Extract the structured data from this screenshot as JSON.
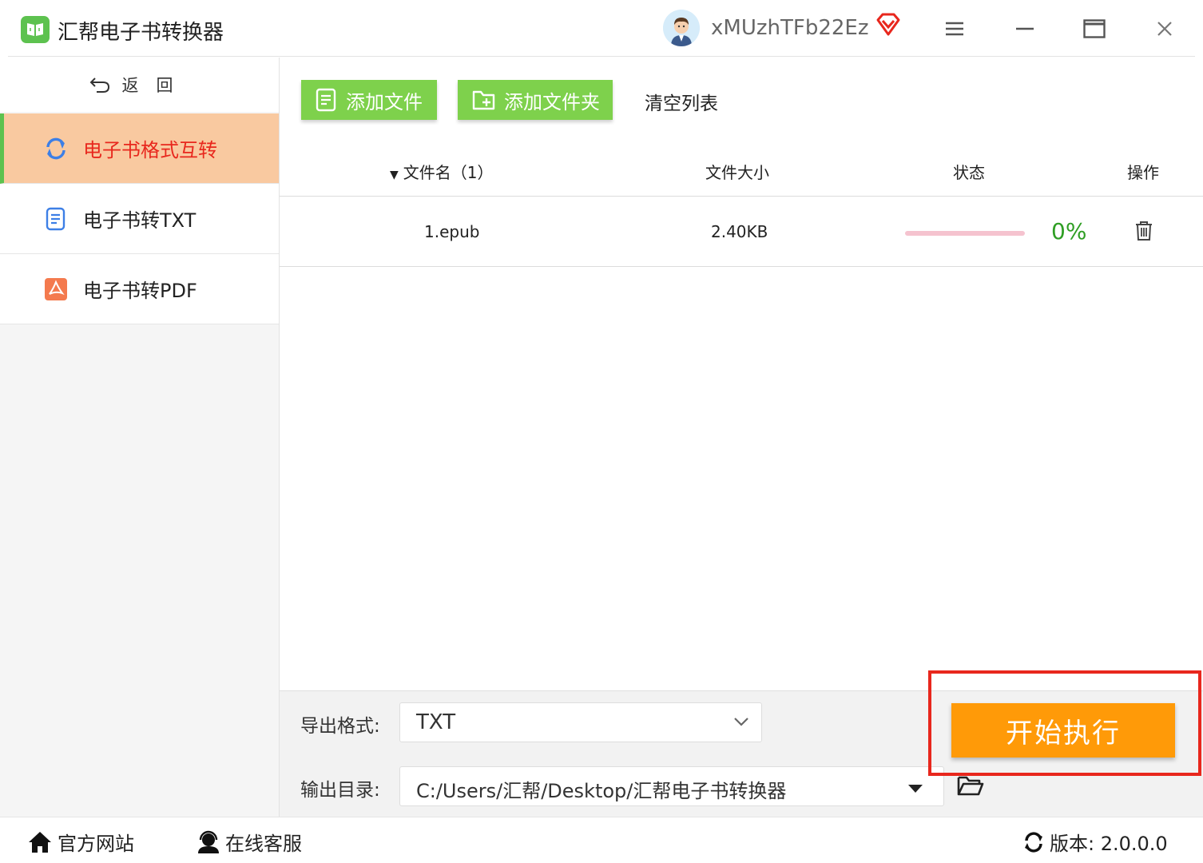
{
  "app": {
    "title": "汇帮电子书转换器"
  },
  "user": {
    "name": "xMUzhTFb22Ez"
  },
  "icons": {
    "logo": "book-icon",
    "avatar": "user-avatar",
    "vip": "diamond-icon",
    "menu": "menu-icon",
    "minimize": "minimize-icon",
    "maximize": "maximize-icon",
    "close": "close-icon"
  },
  "sidebar": {
    "back_label": "返回",
    "items": [
      {
        "label": "电子书格式互转",
        "icon": "refresh-icon",
        "active": true
      },
      {
        "label": "电子书转TXT",
        "icon": "document-icon",
        "active": false
      },
      {
        "label": "电子书转PDF",
        "icon": "pdf-icon",
        "active": false
      }
    ]
  },
  "toolbar": {
    "add_file": "添加文件",
    "add_folder": "添加文件夹",
    "clear_list": "清空列表"
  },
  "table": {
    "headers": {
      "name": "文件名（1）",
      "size": "文件大小",
      "status": "状态",
      "action": "操作"
    },
    "rows": [
      {
        "name": "1.epub",
        "size": "2.40KB",
        "progress": 0,
        "percent": "0%"
      }
    ]
  },
  "output": {
    "format_label": "导出格式:",
    "format_value": "TXT",
    "dir_label": "输出目录:",
    "dir_value": "C:/Users/汇帮/Desktop/汇帮电子书转换器"
  },
  "start_button": "开始执行",
  "statusbar": {
    "website": "官方网站",
    "support": "在线客服",
    "version": "版本: 2.0.0.0"
  },
  "colors": {
    "accent_green": "#7ed14c",
    "active_bg": "#f9c9a0",
    "active_text": "#e8271d",
    "start_orange": "#ff9a08",
    "highlight_red": "#e8271d"
  }
}
